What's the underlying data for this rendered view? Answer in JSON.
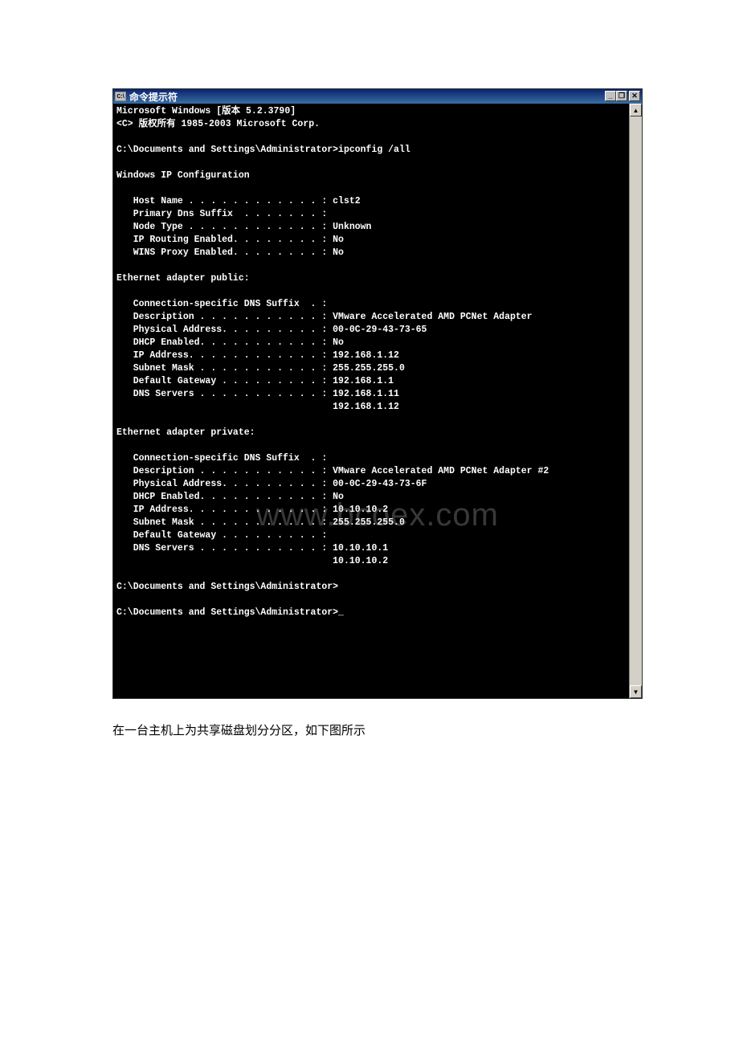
{
  "titlebar": {
    "icon_label": "C:\\",
    "title": "命令提示符",
    "minimize": "_",
    "maximize": "❐",
    "close": "✕"
  },
  "terminal": {
    "lines": [
      "Microsoft Windows [版本 5.2.3790]",
      "<C> 版权所有 1985-2003 Microsoft Corp.",
      "",
      "C:\\Documents and Settings\\Administrator>ipconfig /all",
      "",
      "Windows IP Configuration",
      "",
      "   Host Name . . . . . . . . . . . . : clst2",
      "   Primary Dns Suffix  . . . . . . . :",
      "   Node Type . . . . . . . . . . . . : Unknown",
      "   IP Routing Enabled. . . . . . . . : No",
      "   WINS Proxy Enabled. . . . . . . . : No",
      "",
      "Ethernet adapter public:",
      "",
      "   Connection-specific DNS Suffix  . :",
      "   Description . . . . . . . . . . . : VMware Accelerated AMD PCNet Adapter",
      "   Physical Address. . . . . . . . . : 00-0C-29-43-73-65",
      "   DHCP Enabled. . . . . . . . . . . : No",
      "   IP Address. . . . . . . . . . . . : 192.168.1.12",
      "   Subnet Mask . . . . . . . . . . . : 255.255.255.0",
      "   Default Gateway . . . . . . . . . : 192.168.1.1",
      "   DNS Servers . . . . . . . . . . . : 192.168.1.11",
      "                                       192.168.1.12",
      "",
      "Ethernet adapter private:",
      "",
      "   Connection-specific DNS Suffix  . :",
      "   Description . . . . . . . . . . . : VMware Accelerated AMD PCNet Adapter #2",
      "   Physical Address. . . . . . . . . : 00-0C-29-43-73-6F",
      "   DHCP Enabled. . . . . . . . . . . : No",
      "   IP Address. . . . . . . . . . . . : 10.10.10.2",
      "   Subnet Mask . . . . . . . . . . . : 255.255.255.0",
      "   Default Gateway . . . . . . . . . :",
      "   DNS Servers . . . . . . . . . . . : 10.10.10.1",
      "                                       10.10.10.2",
      "",
      "C:\\Documents and Settings\\Administrator>",
      "",
      "C:\\Documents and Settings\\Administrator>_"
    ]
  },
  "scrollbar": {
    "up": "▲",
    "down": "▼"
  },
  "caption": "在一台主机上为共享磁盘划分分区，如下图所示",
  "watermark": "www.bcoex.com"
}
